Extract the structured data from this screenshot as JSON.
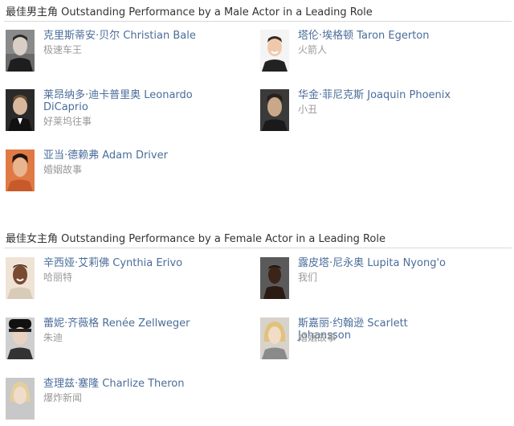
{
  "sections": [
    {
      "title": "最佳男主角 Outstanding Performance by a Male Actor in a Leading Role",
      "entries": [
        {
          "name": "克里斯蒂安·贝尔 Christian Bale",
          "film": "极速车王",
          "avatar": "portrait-christian-bale"
        },
        {
          "name": "塔伦·埃格顿 Taron Egerton",
          "film": "火箭人",
          "avatar": "portrait-taron-egerton"
        },
        {
          "name": "莱昂纳多·迪卡普里奥 Leonardo DiCaprio",
          "film": "好莱坞往事",
          "avatar": "portrait-leonardo-dicaprio"
        },
        {
          "name": "华金·菲尼克斯 Joaquin Phoenix",
          "film": "小丑",
          "avatar": "portrait-joaquin-phoenix"
        },
        {
          "name": "亚当·德赖弗 Adam Driver",
          "film": "婚姻故事",
          "avatar": "portrait-adam-driver"
        }
      ]
    },
    {
      "title": "最佳女主角 Outstanding Performance by a Female Actor in a Leading Role",
      "entries": [
        {
          "name": "辛西娅·艾莉佛 Cynthia Erivo",
          "film": "哈丽特",
          "avatar": "portrait-cynthia-erivo"
        },
        {
          "name": "露皮塔·尼永奥 Lupita Nyong'o",
          "film": "我们",
          "avatar": "portrait-lupita-nyongo"
        },
        {
          "name": "蕾妮·齐薇格 Renée Zellweger",
          "film": "朱迪",
          "avatar": "portrait-renee-zellweger"
        },
        {
          "name": "斯嘉丽·约翰逊 Scarlett Johansson",
          "film": "婚姻故事",
          "avatar": "portrait-scarlett-johansson"
        },
        {
          "name": "查理兹·塞隆 Charlize Theron",
          "film": "爆炸新闻",
          "avatar": "portrait-charlize-theron"
        }
      ]
    }
  ],
  "colors": {
    "name_link": "#4a6d9a",
    "film": "#999999",
    "title": "#333333",
    "rule": "#d9d9d9"
  }
}
